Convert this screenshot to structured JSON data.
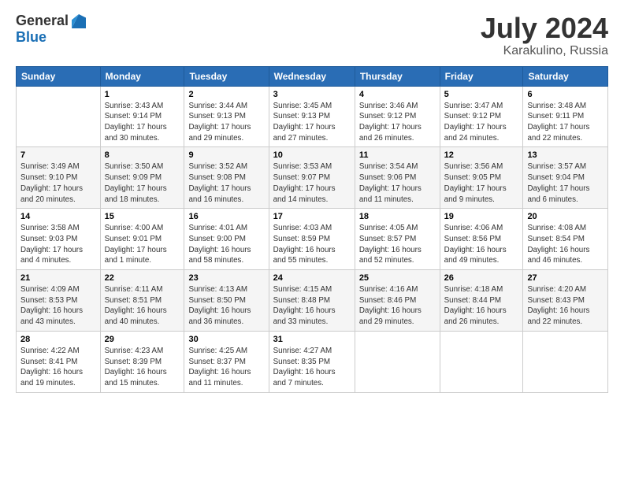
{
  "logo": {
    "general": "General",
    "blue": "Blue"
  },
  "header": {
    "month_year": "July 2024",
    "location": "Karakulino, Russia"
  },
  "days_of_week": [
    "Sunday",
    "Monday",
    "Tuesday",
    "Wednesday",
    "Thursday",
    "Friday",
    "Saturday"
  ],
  "weeks": [
    [
      {
        "day": "",
        "info": ""
      },
      {
        "day": "1",
        "info": "Sunrise: 3:43 AM\nSunset: 9:14 PM\nDaylight: 17 hours\nand 30 minutes."
      },
      {
        "day": "2",
        "info": "Sunrise: 3:44 AM\nSunset: 9:13 PM\nDaylight: 17 hours\nand 29 minutes."
      },
      {
        "day": "3",
        "info": "Sunrise: 3:45 AM\nSunset: 9:13 PM\nDaylight: 17 hours\nand 27 minutes."
      },
      {
        "day": "4",
        "info": "Sunrise: 3:46 AM\nSunset: 9:12 PM\nDaylight: 17 hours\nand 26 minutes."
      },
      {
        "day": "5",
        "info": "Sunrise: 3:47 AM\nSunset: 9:12 PM\nDaylight: 17 hours\nand 24 minutes."
      },
      {
        "day": "6",
        "info": "Sunrise: 3:48 AM\nSunset: 9:11 PM\nDaylight: 17 hours\nand 22 minutes."
      }
    ],
    [
      {
        "day": "7",
        "info": "Sunrise: 3:49 AM\nSunset: 9:10 PM\nDaylight: 17 hours\nand 20 minutes."
      },
      {
        "day": "8",
        "info": "Sunrise: 3:50 AM\nSunset: 9:09 PM\nDaylight: 17 hours\nand 18 minutes."
      },
      {
        "day": "9",
        "info": "Sunrise: 3:52 AM\nSunset: 9:08 PM\nDaylight: 17 hours\nand 16 minutes."
      },
      {
        "day": "10",
        "info": "Sunrise: 3:53 AM\nSunset: 9:07 PM\nDaylight: 17 hours\nand 14 minutes."
      },
      {
        "day": "11",
        "info": "Sunrise: 3:54 AM\nSunset: 9:06 PM\nDaylight: 17 hours\nand 11 minutes."
      },
      {
        "day": "12",
        "info": "Sunrise: 3:56 AM\nSunset: 9:05 PM\nDaylight: 17 hours\nand 9 minutes."
      },
      {
        "day": "13",
        "info": "Sunrise: 3:57 AM\nSunset: 9:04 PM\nDaylight: 17 hours\nand 6 minutes."
      }
    ],
    [
      {
        "day": "14",
        "info": "Sunrise: 3:58 AM\nSunset: 9:03 PM\nDaylight: 17 hours\nand 4 minutes."
      },
      {
        "day": "15",
        "info": "Sunrise: 4:00 AM\nSunset: 9:01 PM\nDaylight: 17 hours\nand 1 minute."
      },
      {
        "day": "16",
        "info": "Sunrise: 4:01 AM\nSunset: 9:00 PM\nDaylight: 16 hours\nand 58 minutes."
      },
      {
        "day": "17",
        "info": "Sunrise: 4:03 AM\nSunset: 8:59 PM\nDaylight: 16 hours\nand 55 minutes."
      },
      {
        "day": "18",
        "info": "Sunrise: 4:05 AM\nSunset: 8:57 PM\nDaylight: 16 hours\nand 52 minutes."
      },
      {
        "day": "19",
        "info": "Sunrise: 4:06 AM\nSunset: 8:56 PM\nDaylight: 16 hours\nand 49 minutes."
      },
      {
        "day": "20",
        "info": "Sunrise: 4:08 AM\nSunset: 8:54 PM\nDaylight: 16 hours\nand 46 minutes."
      }
    ],
    [
      {
        "day": "21",
        "info": "Sunrise: 4:09 AM\nSunset: 8:53 PM\nDaylight: 16 hours\nand 43 minutes."
      },
      {
        "day": "22",
        "info": "Sunrise: 4:11 AM\nSunset: 8:51 PM\nDaylight: 16 hours\nand 40 minutes."
      },
      {
        "day": "23",
        "info": "Sunrise: 4:13 AM\nSunset: 8:50 PM\nDaylight: 16 hours\nand 36 minutes."
      },
      {
        "day": "24",
        "info": "Sunrise: 4:15 AM\nSunset: 8:48 PM\nDaylight: 16 hours\nand 33 minutes."
      },
      {
        "day": "25",
        "info": "Sunrise: 4:16 AM\nSunset: 8:46 PM\nDaylight: 16 hours\nand 29 minutes."
      },
      {
        "day": "26",
        "info": "Sunrise: 4:18 AM\nSunset: 8:44 PM\nDaylight: 16 hours\nand 26 minutes."
      },
      {
        "day": "27",
        "info": "Sunrise: 4:20 AM\nSunset: 8:43 PM\nDaylight: 16 hours\nand 22 minutes."
      }
    ],
    [
      {
        "day": "28",
        "info": "Sunrise: 4:22 AM\nSunset: 8:41 PM\nDaylight: 16 hours\nand 19 minutes."
      },
      {
        "day": "29",
        "info": "Sunrise: 4:23 AM\nSunset: 8:39 PM\nDaylight: 16 hours\nand 15 minutes."
      },
      {
        "day": "30",
        "info": "Sunrise: 4:25 AM\nSunset: 8:37 PM\nDaylight: 16 hours\nand 11 minutes."
      },
      {
        "day": "31",
        "info": "Sunrise: 4:27 AM\nSunset: 8:35 PM\nDaylight: 16 hours\nand 7 minutes."
      },
      {
        "day": "",
        "info": ""
      },
      {
        "day": "",
        "info": ""
      },
      {
        "day": "",
        "info": ""
      }
    ]
  ]
}
